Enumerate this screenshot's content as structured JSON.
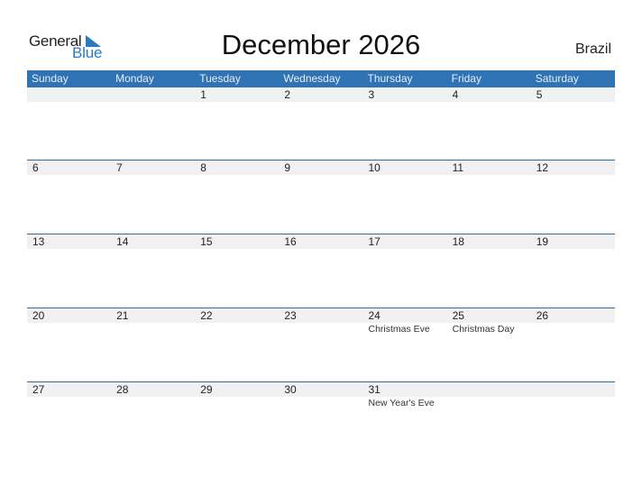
{
  "logo": {
    "line1": "General",
    "line2": "Blue"
  },
  "title": "December 2026",
  "country": "Brazil",
  "colors": {
    "header_bg": "#2f73b5",
    "accent": "#2a7ac0",
    "row_bg": "#f1f1f1"
  },
  "weekdays": [
    "Sunday",
    "Monday",
    "Tuesday",
    "Wednesday",
    "Thursday",
    "Friday",
    "Saturday"
  ],
  "weeks": [
    {
      "days": [
        "",
        "",
        "1",
        "2",
        "3",
        "4",
        "5"
      ],
      "events": [
        "",
        "",
        "",
        "",
        "",
        "",
        ""
      ]
    },
    {
      "days": [
        "6",
        "7",
        "8",
        "9",
        "10",
        "11",
        "12"
      ],
      "events": [
        "",
        "",
        "",
        "",
        "",
        "",
        ""
      ]
    },
    {
      "days": [
        "13",
        "14",
        "15",
        "16",
        "17",
        "18",
        "19"
      ],
      "events": [
        "",
        "",
        "",
        "",
        "",
        "",
        ""
      ]
    },
    {
      "days": [
        "20",
        "21",
        "22",
        "23",
        "24",
        "25",
        "26"
      ],
      "events": [
        "",
        "",
        "",
        "",
        "Christmas Eve",
        "Christmas Day",
        ""
      ]
    },
    {
      "days": [
        "27",
        "28",
        "29",
        "30",
        "31",
        "",
        ""
      ],
      "events": [
        "",
        "",
        "",
        "",
        "New Year's Eve",
        "",
        ""
      ]
    }
  ]
}
